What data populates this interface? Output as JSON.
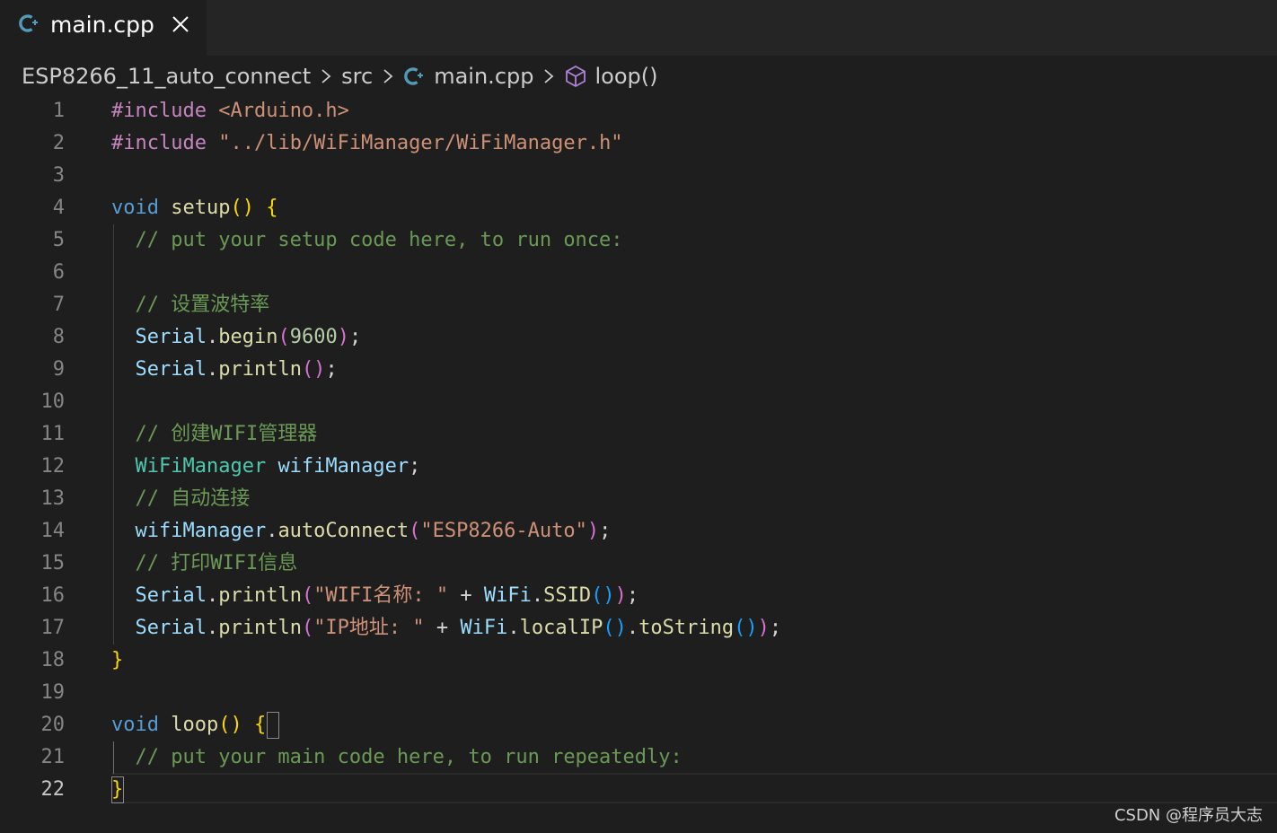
{
  "tab": {
    "label": "main.cpp",
    "icon": "cpp-file-icon",
    "close_icon": "close-icon"
  },
  "breadcrumb": {
    "items": [
      "ESP8266_11_auto_connect",
      "src",
      "main.cpp",
      "loop()"
    ]
  },
  "editor": {
    "active_line": 22,
    "lines": [
      {
        "n": "1",
        "tokens": [
          {
            "t": "#include ",
            "c": "pp"
          },
          {
            "t": "<Arduino.h>",
            "c": "str"
          }
        ]
      },
      {
        "n": "2",
        "tokens": [
          {
            "t": "#include ",
            "c": "pp"
          },
          {
            "t": "\"../lib/WiFiManager/WiFiManager.h\"",
            "c": "str"
          }
        ]
      },
      {
        "n": "3",
        "tokens": []
      },
      {
        "n": "4",
        "tokens": [
          {
            "t": "void",
            "c": "kw"
          },
          {
            "t": " ",
            "c": "def"
          },
          {
            "t": "setup",
            "c": "fn"
          },
          {
            "t": "()",
            "c": "p1"
          },
          {
            "t": " ",
            "c": "def"
          },
          {
            "t": "{",
            "c": "p1"
          }
        ]
      },
      {
        "n": "5",
        "tokens": [
          {
            "t": "  // put your setup code here, to run once:",
            "c": "cm"
          }
        ]
      },
      {
        "n": "6",
        "tokens": []
      },
      {
        "n": "7",
        "tokens": [
          {
            "t": "  // 设置波特率",
            "c": "cm"
          }
        ]
      },
      {
        "n": "8",
        "tokens": [
          {
            "t": "  Serial",
            "c": "var"
          },
          {
            "t": ".",
            "c": "def"
          },
          {
            "t": "begin",
            "c": "fn"
          },
          {
            "t": "(",
            "c": "p2"
          },
          {
            "t": "9600",
            "c": "num"
          },
          {
            "t": ")",
            "c": "p2"
          },
          {
            "t": ";",
            "c": "def"
          }
        ]
      },
      {
        "n": "9",
        "tokens": [
          {
            "t": "  Serial",
            "c": "var"
          },
          {
            "t": ".",
            "c": "def"
          },
          {
            "t": "println",
            "c": "fn"
          },
          {
            "t": "()",
            "c": "p2"
          },
          {
            "t": ";",
            "c": "def"
          }
        ]
      },
      {
        "n": "10",
        "tokens": []
      },
      {
        "n": "11",
        "tokens": [
          {
            "t": "  // 创建WIFI管理器",
            "c": "cm"
          }
        ]
      },
      {
        "n": "12",
        "tokens": [
          {
            "t": "  WiFiManager",
            "c": "type"
          },
          {
            "t": " ",
            "c": "def"
          },
          {
            "t": "wifiManager",
            "c": "var"
          },
          {
            "t": ";",
            "c": "def"
          }
        ]
      },
      {
        "n": "13",
        "tokens": [
          {
            "t": "  // 自动连接",
            "c": "cm"
          }
        ]
      },
      {
        "n": "14",
        "tokens": [
          {
            "t": "  wifiManager",
            "c": "var"
          },
          {
            "t": ".",
            "c": "def"
          },
          {
            "t": "autoConnect",
            "c": "fn"
          },
          {
            "t": "(",
            "c": "p2"
          },
          {
            "t": "\"ESP8266-Auto\"",
            "c": "str"
          },
          {
            "t": ")",
            "c": "p2"
          },
          {
            "t": ";",
            "c": "def"
          }
        ]
      },
      {
        "n": "15",
        "tokens": [
          {
            "t": "  // 打印WIFI信息",
            "c": "cm"
          }
        ]
      },
      {
        "n": "16",
        "tokens": [
          {
            "t": "  Serial",
            "c": "var"
          },
          {
            "t": ".",
            "c": "def"
          },
          {
            "t": "println",
            "c": "fn"
          },
          {
            "t": "(",
            "c": "p2"
          },
          {
            "t": "\"WIFI名称: \"",
            "c": "str"
          },
          {
            "t": " + ",
            "c": "def"
          },
          {
            "t": "WiFi",
            "c": "var"
          },
          {
            "t": ".",
            "c": "def"
          },
          {
            "t": "SSID",
            "c": "fn"
          },
          {
            "t": "()",
            "c": "p3"
          },
          {
            "t": ")",
            "c": "p2"
          },
          {
            "t": ";",
            "c": "def"
          }
        ]
      },
      {
        "n": "17",
        "tokens": [
          {
            "t": "  Serial",
            "c": "var"
          },
          {
            "t": ".",
            "c": "def"
          },
          {
            "t": "println",
            "c": "fn"
          },
          {
            "t": "(",
            "c": "p2"
          },
          {
            "t": "\"IP地址: \"",
            "c": "str"
          },
          {
            "t": " + ",
            "c": "def"
          },
          {
            "t": "WiFi",
            "c": "var"
          },
          {
            "t": ".",
            "c": "def"
          },
          {
            "t": "localIP",
            "c": "fn"
          },
          {
            "t": "()",
            "c": "p3"
          },
          {
            "t": ".",
            "c": "def"
          },
          {
            "t": "toString",
            "c": "fn"
          },
          {
            "t": "()",
            "c": "p3"
          },
          {
            "t": ")",
            "c": "p2"
          },
          {
            "t": ";",
            "c": "def"
          }
        ]
      },
      {
        "n": "18",
        "tokens": [
          {
            "t": "}",
            "c": "p1"
          }
        ]
      },
      {
        "n": "19",
        "tokens": []
      },
      {
        "n": "20",
        "tokens": [
          {
            "t": "void",
            "c": "kw"
          },
          {
            "t": " ",
            "c": "def"
          },
          {
            "t": "loop",
            "c": "fn"
          },
          {
            "t": "()",
            "c": "p1"
          },
          {
            "t": " ",
            "c": "def"
          },
          {
            "t": "{",
            "c": "p1"
          }
        ]
      },
      {
        "n": "21",
        "tokens": [
          {
            "t": "  // put your main code here, to run repeatedly:",
            "c": "cm"
          }
        ]
      },
      {
        "n": "22",
        "tokens": [
          {
            "t": "}",
            "c": "p1"
          }
        ]
      }
    ]
  },
  "watermark": "CSDN @程序员大志"
}
